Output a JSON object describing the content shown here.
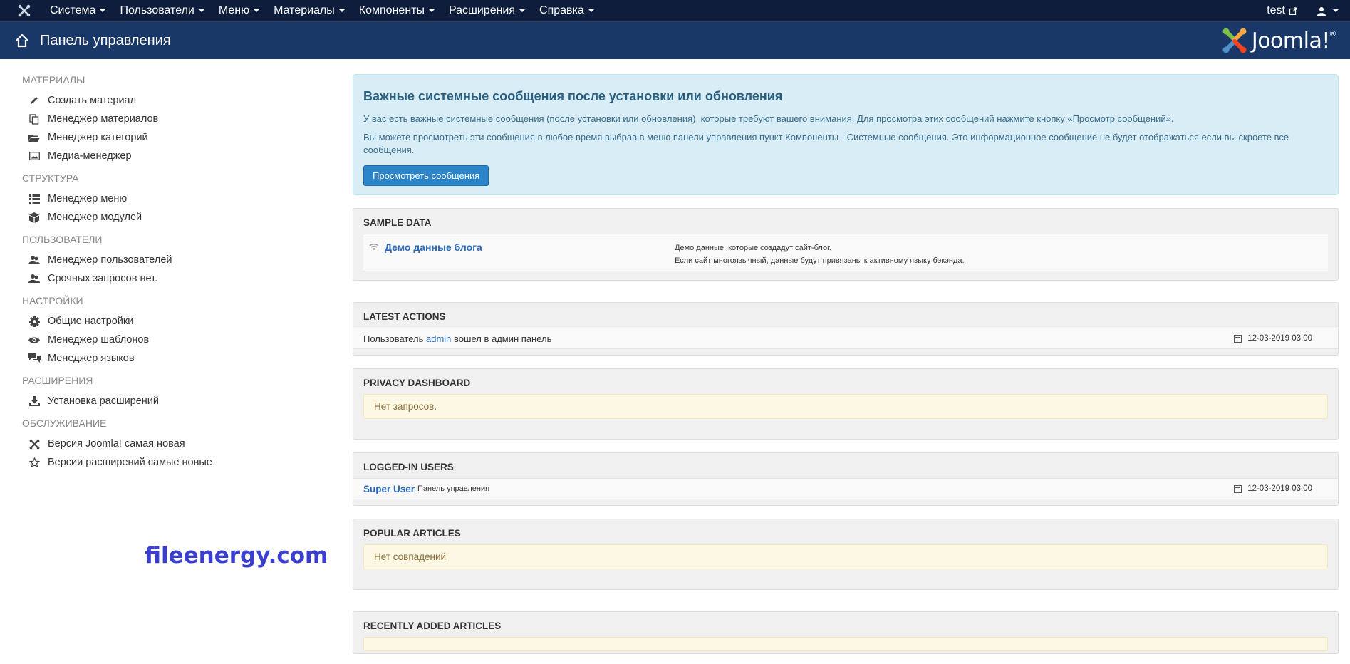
{
  "topnav": {
    "logo_icon": "joomla-icon",
    "menus": [
      "Система",
      "Пользователи",
      "Меню",
      "Материалы",
      "Компоненты",
      "Расширения",
      "Справка"
    ],
    "user": "test",
    "user_icon": "user-icon"
  },
  "header": {
    "title": "Панель управления",
    "brand": "Joomla!",
    "brand_mark": "®"
  },
  "sidebar": {
    "sections": [
      {
        "title": "МАТЕРИАЛЫ",
        "items": [
          {
            "label": "Создать материал",
            "icon": "pencil-icon"
          },
          {
            "label": "Менеджер материалов",
            "icon": "copy-icon"
          },
          {
            "label": "Менеджер категорий",
            "icon": "folder-icon"
          },
          {
            "label": "Медиа-менеджер",
            "icon": "image-icon"
          }
        ]
      },
      {
        "title": "СТРУКТУРА",
        "items": [
          {
            "label": "Менеджер меню",
            "icon": "list-icon"
          },
          {
            "label": "Менеджер модулей",
            "icon": "cube-icon"
          }
        ]
      },
      {
        "title": "ПОЛЬЗОВАТЕЛИ",
        "items": [
          {
            "label": "Менеджер пользователей",
            "icon": "users-icon"
          },
          {
            "label": "Срочных запросов нет.",
            "icon": "users-icon"
          }
        ]
      },
      {
        "title": "НАСТРОЙКИ",
        "items": [
          {
            "label": "Общие настройки",
            "icon": "gear-icon"
          },
          {
            "label": "Менеджер шаблонов",
            "icon": "eye-icon"
          },
          {
            "label": "Менеджер языков",
            "icon": "comments-icon"
          }
        ]
      },
      {
        "title": "РАСШИРЕНИЯ",
        "items": [
          {
            "label": "Установка расширений",
            "icon": "download-icon"
          }
        ]
      },
      {
        "title": "ОБСЛУЖИВАНИЕ",
        "items": [
          {
            "label": "Версия Joomla! самая новая",
            "icon": "joomla-icon"
          },
          {
            "label": "Версии расширений самые новые",
            "icon": "star-icon"
          }
        ]
      }
    ]
  },
  "watermark": "fileenergy.com",
  "alert": {
    "title": "Важные системные сообщения после установки или обновления",
    "p1": "У вас есть важные системные сообщения (после установки или обновления), которые требуют вашего внимания. Для просмотра этих сообщений нажмите кнопку «Просмотр сообщений».",
    "p2": "Вы можете просмотреть эти сообщения в любое время выбрав в меню панели управления пункт Компоненты - Системные сообщения. Это информационное сообщение не будет отображаться если вы скроете все сообщения.",
    "button": "Просмотреть сообщения"
  },
  "sample_data": {
    "title": "SAMPLE DATA",
    "item_label": "Демо данные блога",
    "item_icon": "wifi-icon",
    "desc1": "Демо данные, которые создадут сайт-блог.",
    "desc2": "Если сайт многоязычный, данные будут привязаны к активному языку бэкэнда."
  },
  "latest_actions": {
    "title": "LATEST ACTIONS",
    "prefix": "Пользователь",
    "user": "admin",
    "suffix": "вошел в админ панель",
    "date": "12-03-2019 03:00"
  },
  "privacy": {
    "title": "PRIVACY DASHBOARD",
    "message": "Нет запросов."
  },
  "logged_in": {
    "title": "LOGGED-IN USERS",
    "user": "Super User",
    "location": "Панель управления",
    "date": "12-03-2019 03:00"
  },
  "popular": {
    "title": "POPULAR ARTICLES",
    "message": "Нет совпадений"
  },
  "recent": {
    "title": "RECENTLY ADDED ARTICLES"
  }
}
